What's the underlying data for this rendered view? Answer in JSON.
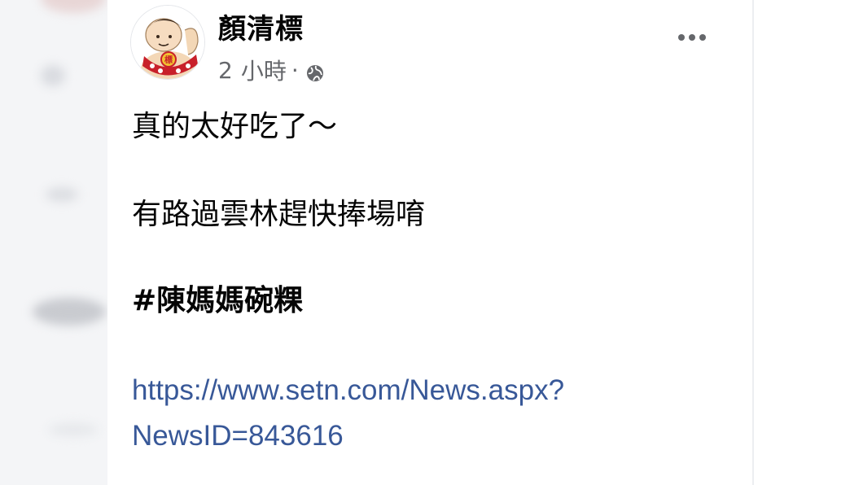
{
  "post": {
    "author": "顏清標",
    "time_value": "2",
    "time_unit": "小時",
    "separator": "·",
    "lines": [
      "真的太好吃了～",
      "有路過雲林趕快捧場唷"
    ],
    "hashtag": "#陳媽媽碗粿",
    "link_line1": "https://www.setn.com/News.aspx?",
    "link_line2": "NewsID=843616"
  },
  "icons": {
    "privacy": "globe-icon",
    "menu": "more-options-icon"
  },
  "colors": {
    "link": "#385898",
    "meta": "#65676b",
    "text": "#050505"
  }
}
